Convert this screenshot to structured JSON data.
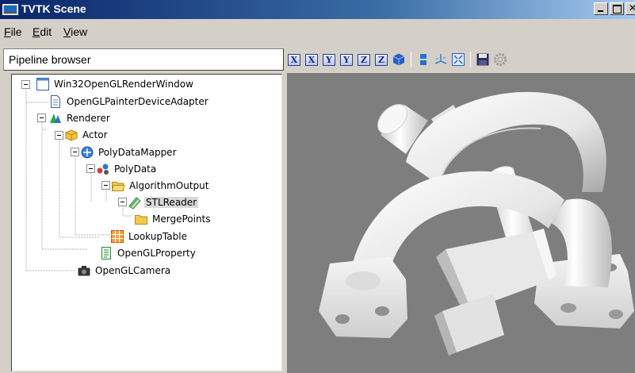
{
  "window": {
    "title": "TVTK Scene"
  },
  "menu": [
    {
      "label": "File",
      "mnemonic": "F",
      "rest": "ile"
    },
    {
      "label": "Edit",
      "mnemonic": "E",
      "rest": "dit"
    },
    {
      "label": "View",
      "mnemonic": "V",
      "rest": "iew"
    }
  ],
  "pipeline": {
    "header": "Pipeline browser",
    "nodes": [
      {
        "label": "Win32OpenGLRenderWindow",
        "icon": "window-icon"
      },
      {
        "label": "OpenGLPainterDeviceAdapter",
        "icon": "document-icon"
      },
      {
        "label": "Renderer",
        "icon": "renderer-icon"
      },
      {
        "label": "Actor",
        "icon": "actor-icon"
      },
      {
        "label": "PolyDataMapper",
        "icon": "mapper-icon"
      },
      {
        "label": "PolyData",
        "icon": "polydata-icon"
      },
      {
        "label": "AlgorithmOutput",
        "icon": "folder-open-icon"
      },
      {
        "label": "STLReader",
        "icon": "reader-icon",
        "selected": true
      },
      {
        "label": "MergePoints",
        "icon": "folder-icon"
      },
      {
        "label": "LookupTable",
        "icon": "lookup-table-icon"
      },
      {
        "label": "OpenGLProperty",
        "icon": "property-icon"
      },
      {
        "label": "OpenGLCamera",
        "icon": "camera-icon"
      }
    ]
  },
  "toolbar": {
    "buttons": [
      {
        "name": "view-plus-x",
        "glyph": "X"
      },
      {
        "name": "view-minus-x",
        "glyph": "X"
      },
      {
        "name": "view-plus-y",
        "glyph": "Y"
      },
      {
        "name": "view-minus-y",
        "glyph": "Y"
      },
      {
        "name": "view-plus-z",
        "glyph": "Z"
      },
      {
        "name": "view-minus-z",
        "glyph": "Z"
      },
      {
        "name": "isometric-view",
        "icon": "cube-icon"
      },
      {
        "name": "parallel-projection",
        "icon": "projection-icon"
      },
      {
        "name": "show-axes",
        "icon": "axes-icon"
      },
      {
        "name": "full-screen",
        "icon": "fullscreen-icon"
      },
      {
        "name": "save-snapshot",
        "icon": "floppy-disk-icon"
      },
      {
        "name": "configure-scene",
        "icon": "gear-icon"
      }
    ]
  },
  "scene": {
    "background": "#7e7e7e",
    "model_color": "#f2f2f2"
  }
}
